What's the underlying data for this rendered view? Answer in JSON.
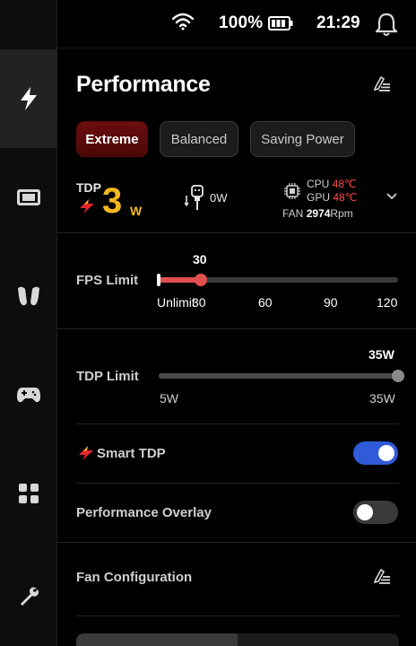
{
  "status": {
    "battery": "100%",
    "time": "21:29"
  },
  "panel": {
    "title": "Performance"
  },
  "modes": [
    {
      "label": "Extreme",
      "active": true
    },
    {
      "label": "Balanced",
      "active": false
    },
    {
      "label": "Saving Power",
      "active": false
    }
  ],
  "stats": {
    "tdp_label": "TDP",
    "tdp_value": "3",
    "tdp_unit": "W",
    "plug_value": "0W",
    "cpu_label": "CPU",
    "cpu_temp": "48℃",
    "gpu_label": "GPU",
    "gpu_temp": "48℃",
    "fan_label": "FAN",
    "fan_value": "2974",
    "fan_unit": "Rpm"
  },
  "fps_limit": {
    "label": "FPS Limit",
    "value": "30",
    "ticks": [
      "Unlimit",
      "30",
      "60",
      "90",
      "120"
    ]
  },
  "tdp_limit": {
    "label": "TDP Limit",
    "value": "35W",
    "min_label": "5W",
    "max_label": "35W"
  },
  "smart_tdp": {
    "label": "Smart TDP",
    "on": true
  },
  "performance_overlay": {
    "label": "Performance Overlay",
    "on": false
  },
  "fan_configuration": {
    "label": "Fan Configuration"
  },
  "colors": {
    "accent_red": "#e0504f",
    "toggle_on": "#2f5bd8",
    "tdp_yellow": "#f2b81f",
    "temp_red": "#ff4a4a"
  },
  "icons": {
    "rail": [
      "bolt-icon",
      "screen-icon",
      "grip-icon",
      "gamepad-icon",
      "apps-grid-icon",
      "wrench-icon"
    ],
    "status": [
      "wifi-icon",
      "battery-icon",
      "bell-icon"
    ]
  }
}
